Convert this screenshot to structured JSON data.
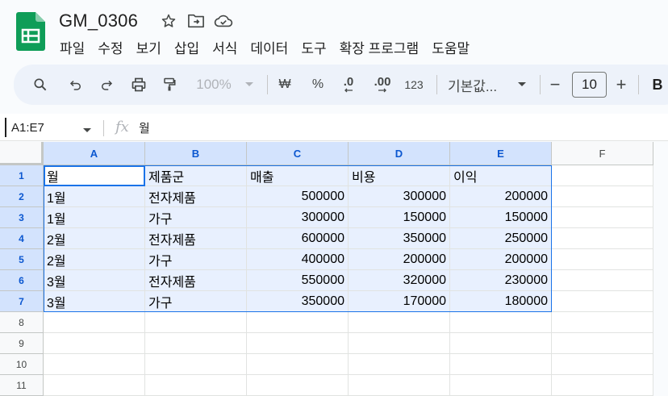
{
  "doc": {
    "title": "GM_0306"
  },
  "icons": {
    "star": "star-icon",
    "move": "move-to-folder-icon",
    "cloud": "cloud-saved-icon"
  },
  "menu": [
    "파일",
    "수정",
    "보기",
    "삽입",
    "서식",
    "데이터",
    "도구",
    "확장 프로그램",
    "도움말"
  ],
  "toolbar": {
    "zoom": "100%",
    "currency": "₩",
    "percent": "%",
    "dec_decrease": ".0",
    "dec_increase": ".00",
    "number_format": "123",
    "font": "기본값...",
    "font_size": "10",
    "minus": "−",
    "plus": "+",
    "bold": "B"
  },
  "formula_bar": {
    "name_box": "A1:E7",
    "fx": "fx",
    "content": "월"
  },
  "columns": [
    "A",
    "B",
    "C",
    "D",
    "E",
    "F"
  ],
  "rows": [
    "1",
    "2",
    "3",
    "4",
    "5",
    "6",
    "7",
    "8",
    "9",
    "10",
    "11"
  ],
  "cells": [
    [
      "월",
      "제품군",
      "매출",
      "비용",
      "이익"
    ],
    [
      "1월",
      "전자제품",
      "500000",
      "300000",
      "200000"
    ],
    [
      "1월",
      "가구",
      "300000",
      "150000",
      "150000"
    ],
    [
      "2월",
      "전자제품",
      "600000",
      "350000",
      "250000"
    ],
    [
      "2월",
      "가구",
      "400000",
      "200000",
      "200000"
    ],
    [
      "3월",
      "전자제품",
      "550000",
      "320000",
      "230000"
    ],
    [
      "3월",
      "가구",
      "350000",
      "170000",
      "180000"
    ]
  ],
  "colors": {
    "selection": "#e8f0fe",
    "header_selected": "#d3e3fd",
    "accent": "#1a73e8",
    "sheets_green": "#0f9d58"
  }
}
